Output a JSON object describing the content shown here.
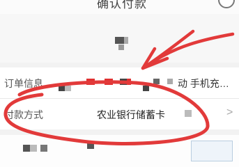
{
  "header": {
    "title": "确认付款"
  },
  "order_info": {
    "label": "订单信息",
    "value": "动 手机充…"
  },
  "payment_method": {
    "label": "付款方式",
    "value": "农业银行储蓄卡",
    "chevron": ">"
  },
  "colors": {
    "annotation": "#e23a3a",
    "redaction_red": "#e03030",
    "redaction_dark": "#444444"
  },
  "icons": {
    "help": "help-circle-icon",
    "chevron": "chevron-right-icon"
  }
}
